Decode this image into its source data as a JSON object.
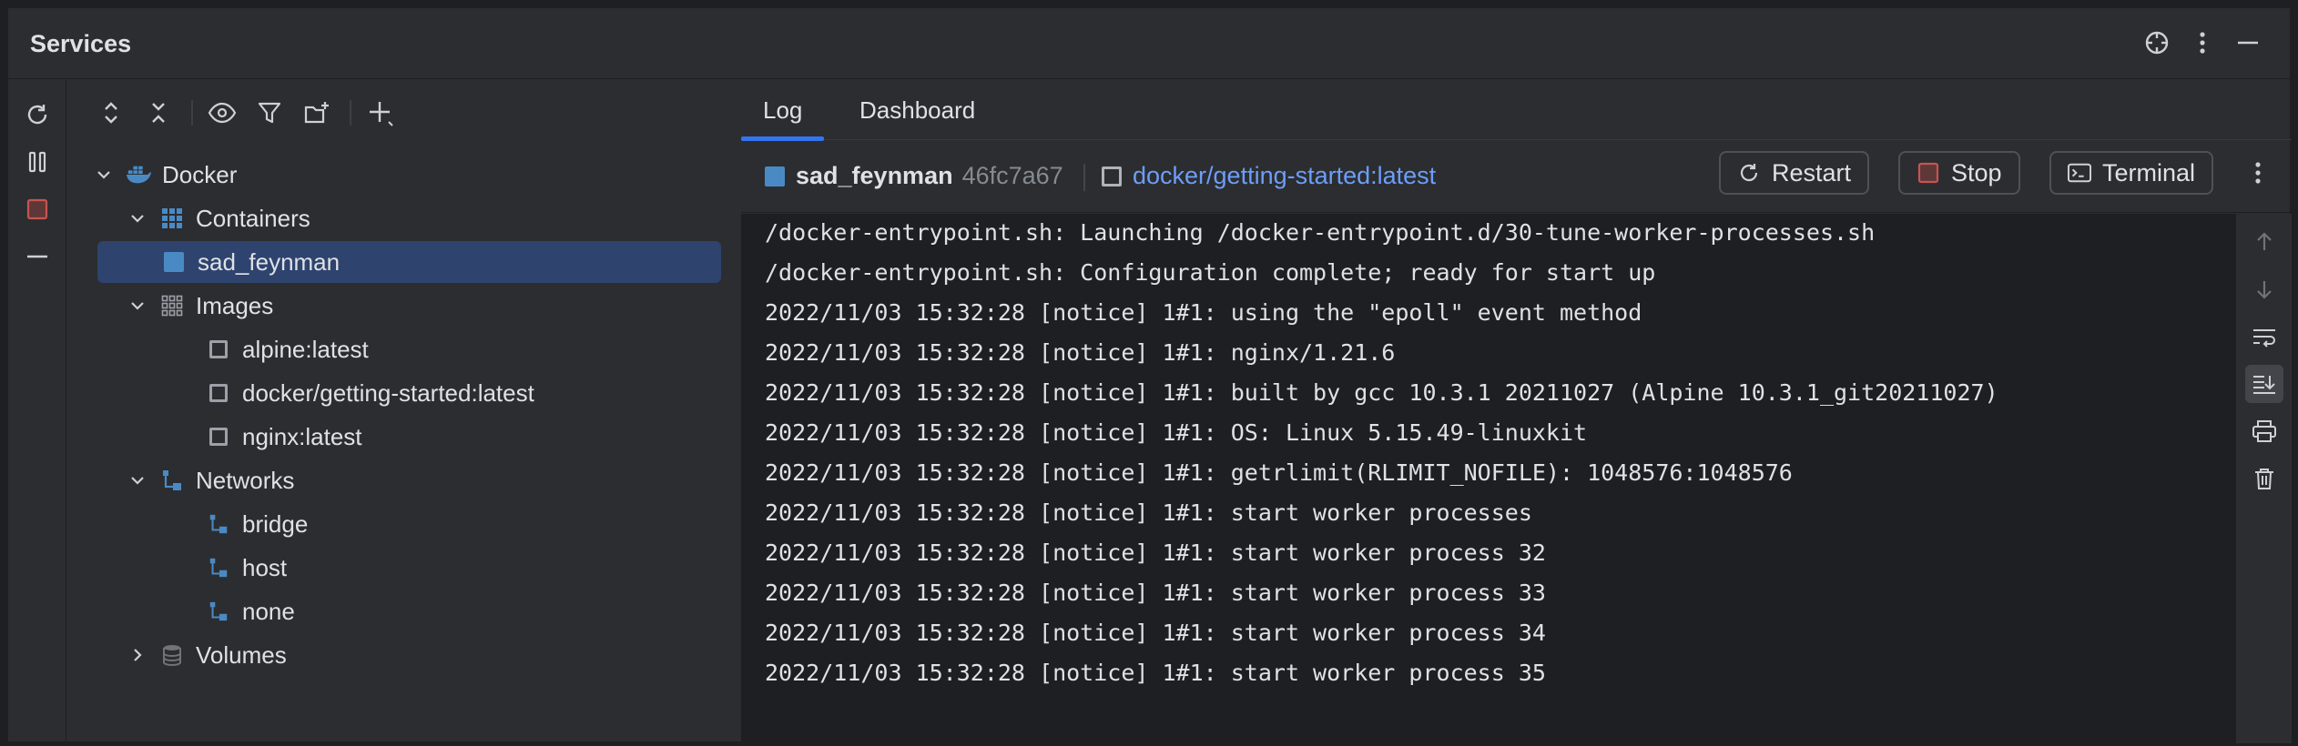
{
  "header": {
    "title": "Services"
  },
  "tree": {
    "docker": "Docker",
    "containers": "Containers",
    "container_item": "sad_feynman",
    "images": "Images",
    "image_items": [
      "alpine:latest",
      "docker/getting-started:latest",
      "nginx:latest"
    ],
    "networks": "Networks",
    "network_items": [
      "bridge",
      "host",
      "none"
    ],
    "volumes": "Volumes"
  },
  "tabs": {
    "log": "Log",
    "dashboard": "Dashboard"
  },
  "info": {
    "container_name": "sad_feynman",
    "container_id": "46fc7a67",
    "image": "docker/getting-started:latest"
  },
  "buttons": {
    "restart": "Restart",
    "stop": "Stop",
    "terminal": "Terminal"
  },
  "log_lines": [
    "/docker-entrypoint.sh: Launching /docker-entrypoint.d/30-tune-worker-processes.sh",
    "/docker-entrypoint.sh: Configuration complete; ready for start up",
    "2022/11/03 15:32:28 [notice] 1#1: using the \"epoll\" event method",
    "2022/11/03 15:32:28 [notice] 1#1: nginx/1.21.6",
    "2022/11/03 15:32:28 [notice] 1#1: built by gcc 10.3.1 20211027 (Alpine 10.3.1_git20211027)",
    "2022/11/03 15:32:28 [notice] 1#1: OS: Linux 5.15.49-linuxkit",
    "2022/11/03 15:32:28 [notice] 1#1: getrlimit(RLIMIT_NOFILE): 1048576:1048576",
    "2022/11/03 15:32:28 [notice] 1#1: start worker processes",
    "2022/11/03 15:32:28 [notice] 1#1: start worker process 32",
    "2022/11/03 15:32:28 [notice] 1#1: start worker process 33",
    "2022/11/03 15:32:28 [notice] 1#1: start worker process 34",
    "2022/11/03 15:32:28 [notice] 1#1: start worker process 35"
  ],
  "colors": {
    "accent": "#3574f0",
    "selection": "#2e436e",
    "link": "#6d9ef8",
    "stop_red": "#c75450",
    "docker_blue": "#4a8ac4"
  }
}
